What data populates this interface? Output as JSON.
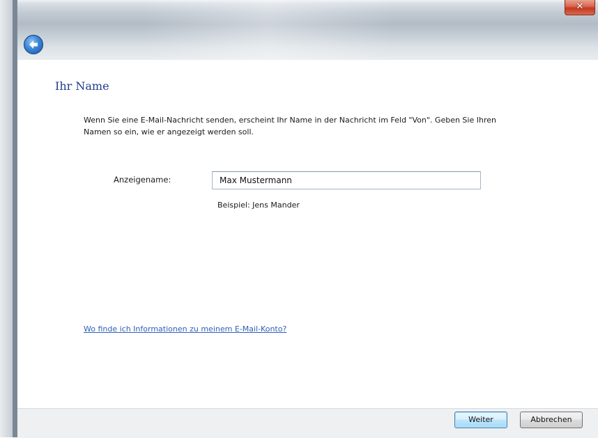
{
  "window": {
    "close_icon": "✕",
    "back_icon": "back-arrow-icon"
  },
  "page": {
    "heading": "Ihr Name",
    "description": "Wenn Sie eine E-Mail-Nachricht senden, erscheint Ihr Name in der Nachricht im Feld \"Von\". Geben Sie Ihren Namen so ein, wie er angezeigt werden soll.",
    "display_name_label": "Anzeigename:",
    "display_name_value": "Max Mustermann",
    "example_text": "Beispiel: Jens Mander",
    "info_link": "Wo finde ich Informationen zu meinem E-Mail-Konto?"
  },
  "footer": {
    "next_label": "Weiter",
    "cancel_label": "Abbrechen"
  },
  "colors": {
    "heading": "#1e3d8f",
    "link": "#2d5fb8",
    "close_button": "#c2391f",
    "back_button": "#3a86d8"
  }
}
